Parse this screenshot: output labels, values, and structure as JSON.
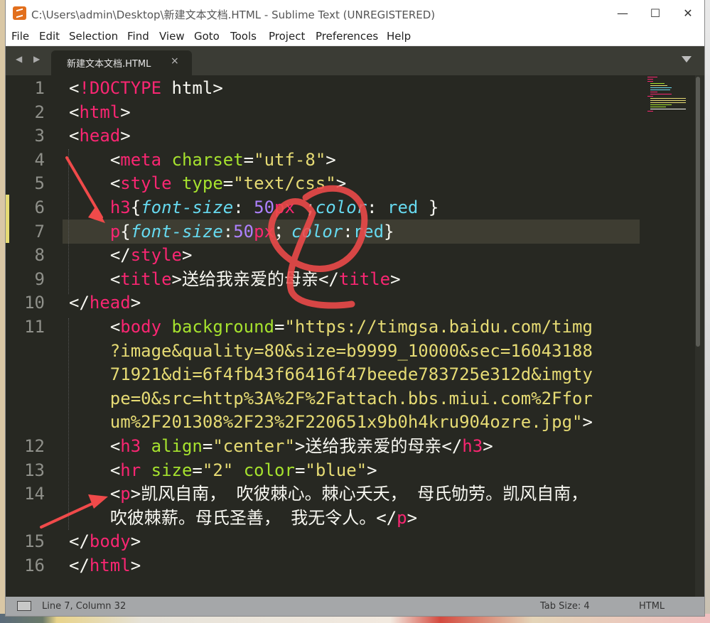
{
  "window": {
    "title": "C:\\Users\\admin\\Desktop\\新建文本文档.HTML - Sublime Text (UNREGISTERED)",
    "controls": {
      "minimize": "—",
      "maximize": "☐",
      "close": "✕"
    }
  },
  "menu": [
    "File",
    "Edit",
    "Selection",
    "Find",
    "View",
    "Goto",
    "Tools",
    "Project",
    "Preferences",
    "Help"
  ],
  "tabs": [
    {
      "label": "新建文本文档.HTML",
      "close": "×",
      "active": true
    }
  ],
  "nav": {
    "arrows": "◀ ▶"
  },
  "editor": {
    "line_numbers": [
      "1",
      "2",
      "3",
      "4",
      "5",
      "6",
      "7",
      "8",
      "9",
      "10",
      "11",
      "",
      "",
      "",
      "",
      "12",
      "13",
      "14",
      "",
      "15",
      "16"
    ],
    "current_line": 7,
    "code_lines": [
      "<!DOCTYPE html>",
      "<html>",
      "<head>",
      "    <meta charset=\"utf-8\">",
      "    <style type=\"text/css\">",
      "    h3{font-size: 50px ;color: red }",
      "    p{font-size:50px；color:red}",
      "    </style>",
      "    <title>送给我亲爱的母亲</title>",
      "</head>",
      "    <body background=\"https://timgsa.baidu.com/timg",
      "    ?image&quality=80&size=b9999_10000&sec=16043188",
      "    71921&di=6f4fb43f66416f47beede783725e312d&imgty",
      "    pe=0&src=http%3A%2F%2Fattach.bbs.miui.com%2Ffor",
      "    um%2F201308%2F23%2F220651x9b0h4kru904ozre.jpg\">",
      "    <h3 align=\"center\">送给我亲爱的母亲</h3>",
      "    <hr size=\"2\" color=\"blue\">",
      "    <p>凯风自南， 吹彼棘心。棘心夭夭， 母氏劬劳。凯风自南，",
      "    吹彼棘薪。母氏圣善， 我无令人。</p>",
      "</body>",
      "</html>"
    ]
  },
  "status": {
    "position": "Line 7, Column 32",
    "tab_size": "Tab Size: 4",
    "syntax": "HTML"
  },
  "colors": {
    "editor_bg": "#272822",
    "tag": "#f92672",
    "attribute": "#a6e22e",
    "string": "#e6db74",
    "number": "#ae81ff",
    "property": "#66d9ef",
    "annotation": "#f04a4a"
  }
}
